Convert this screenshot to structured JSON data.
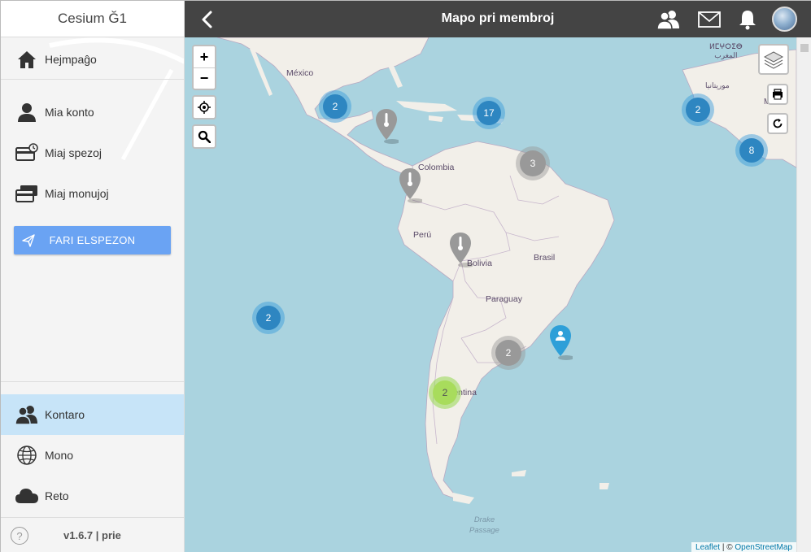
{
  "app": {
    "title": "Cesium Ğ1"
  },
  "sidebar": {
    "items": [
      {
        "label": "Hejmpaĝo",
        "icon": "home-icon"
      },
      {
        "label": "Mia konto",
        "icon": "person-icon"
      },
      {
        "label": "Miaj spezoj",
        "icon": "card-clock-icon"
      },
      {
        "label": "Miaj monujoj",
        "icon": "cards-icon"
      },
      {
        "label": "Kontaro",
        "icon": "people-icon",
        "active": true
      },
      {
        "label": "Mono",
        "icon": "globe-icon"
      },
      {
        "label": "Reto",
        "icon": "cloud-icon"
      }
    ],
    "send_button": "FARI ELSPEZON",
    "help": "?",
    "version": "v1.6.7 | prie"
  },
  "header": {
    "title": "Mapo pri membroj"
  },
  "map": {
    "zoom_in": "+",
    "zoom_out": "−",
    "labels": {
      "mexico": "México",
      "colombia": "Colombia",
      "peru": "Perú",
      "bolivia": "Bolivia",
      "brasil": "Brasil",
      "paraguay": "Paraguay",
      "argentina": "Argentina",
      "drake": "Drake\nPassage",
      "morocco_latin": "ⵍⵎⵖⵔⵉⴱ\nالمغرب",
      "morocco_ar": "موريتانيا",
      "mali": "Mali"
    },
    "clusters": [
      {
        "count": "2",
        "style": "blue"
      },
      {
        "count": "17",
        "style": "blue"
      },
      {
        "count": "3",
        "style": "gray"
      },
      {
        "count": "2",
        "style": "blue"
      },
      {
        "count": "8",
        "style": "blue"
      },
      {
        "count": "2",
        "style": "blue"
      },
      {
        "count": "2",
        "style": "gray"
      },
      {
        "count": "2",
        "style": "green"
      }
    ],
    "attribution": {
      "leaflet": "Leaflet",
      "sep": " | © ",
      "osm": "OpenStreetMap"
    }
  },
  "colors": {
    "header_bg": "#444444",
    "accent": "#6aa3f3",
    "active_bg": "#c7e4f8",
    "sea": "#aad3df",
    "land": "#f2efe9"
  }
}
